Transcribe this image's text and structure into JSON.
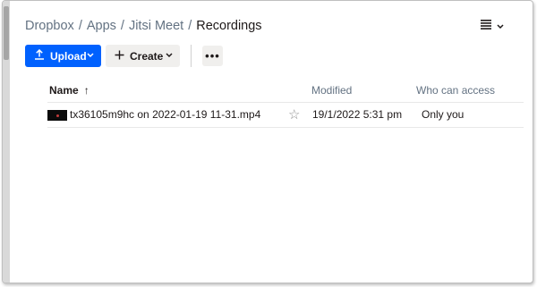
{
  "breadcrumb": {
    "items": [
      "Dropbox",
      "Apps",
      "Jitsi Meet"
    ],
    "current": "Recordings",
    "separator": "/"
  },
  "toolbar": {
    "upload_label": "Upload",
    "create_label": "Create",
    "more_label": "•••"
  },
  "table": {
    "headers": {
      "name": "Name",
      "modified": "Modified",
      "access": "Who can access"
    },
    "sort_arrow": "↑",
    "rows": [
      {
        "name": "tx36105m9hc on 2022-01-19 11-31.mp4",
        "modified": "19/1/2022 5:31 pm",
        "access": "Only you"
      }
    ]
  },
  "colors": {
    "accent": "#0061fe",
    "secondary_button": "#f0efed",
    "muted_text": "#637282"
  },
  "icons": {
    "upload": "upload-icon",
    "create": "plus-icon",
    "view": "list-view-icon",
    "star": "star-icon"
  }
}
